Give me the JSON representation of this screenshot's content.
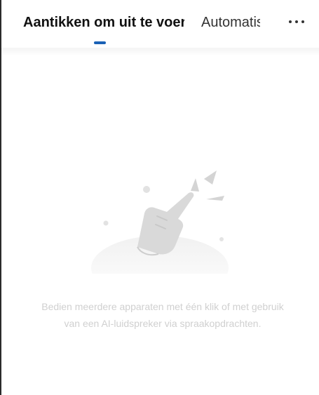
{
  "tabs": [
    {
      "label": "Aantikken om uit te voeren",
      "active": true
    },
    {
      "label": "Automatis",
      "active": false
    }
  ],
  "header": {
    "more_icon": "more-horizontal-icon",
    "accent_color": "#1a61b5"
  },
  "empty_state": {
    "icon": "tap-gesture-icon",
    "message": "Bedien meerdere apparaten met één klik of met gebruik van een AI-luidspreker via spraakopdrachten."
  }
}
